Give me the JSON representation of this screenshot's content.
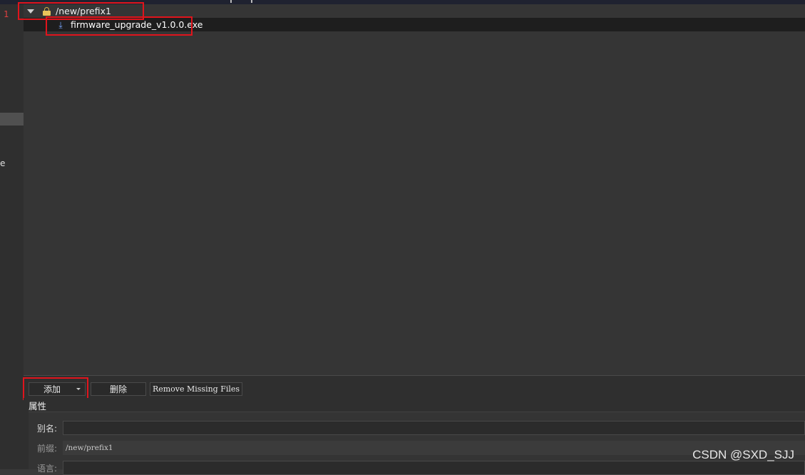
{
  "line_number": "1",
  "left_panel": {
    "truncated_text": "e"
  },
  "tree": {
    "root": {
      "label": "/new/prefix1",
      "icon": "lock-icon",
      "expand_icon": "expand-arrow-icon"
    },
    "children": [
      {
        "label": "firmware_upgrade_v1.0.0.exe",
        "icon": "download-icon",
        "glyph": "⤓"
      }
    ]
  },
  "toolbar": {
    "add_label": "添加",
    "delete_label": "删除",
    "remove_missing_label": "Remove Missing Files"
  },
  "properties": {
    "title": "属性",
    "alias_label": "别名:",
    "alias_value": "",
    "prefix_label": "前缀:",
    "prefix_value": "/new/prefix1",
    "language_label": "语言:",
    "language_value": ""
  },
  "watermark": "CSDN @SXD_SJJ",
  "colors": {
    "highlight_box": "#e0141c",
    "accent_icon": "#7aa6ff",
    "lock": "#e9c35a"
  }
}
